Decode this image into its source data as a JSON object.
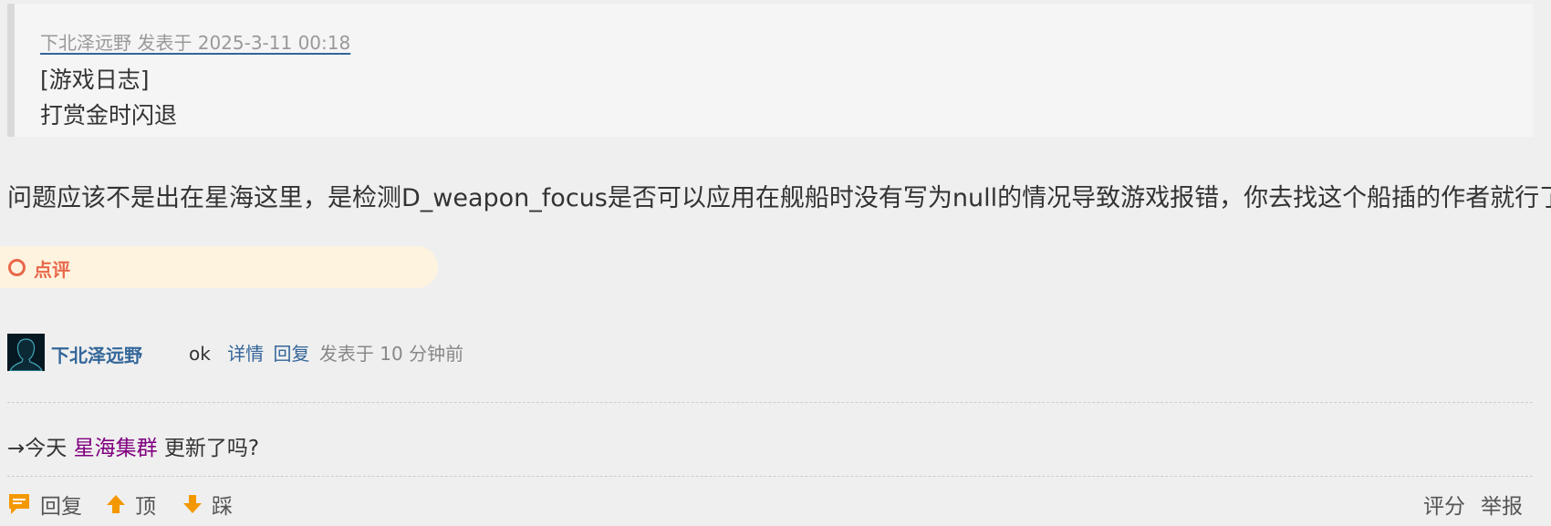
{
  "quote": {
    "meta": "下北泽远野 发表于 2025-3-11 00:18",
    "line1": "[游戏日志]",
    "line2": "打赏金时闪退"
  },
  "post": {
    "text": "问题应该不是出在星海这里，是检测D_weapon_focus是否可以应用在舰船时没有写为null的情况导致游戏报错，你去找这个船插的作者就行了"
  },
  "comments": {
    "label": "点评",
    "items": [
      {
        "username": "下北泽远野",
        "text": "ok",
        "detail_link": "详情",
        "reply_link": "回复",
        "time": "发表于 10 分钟前"
      }
    ]
  },
  "promo": {
    "prefix": "→今天",
    "link": "星海集群",
    "suffix": "更新了吗?"
  },
  "actions": {
    "reply": "回复",
    "up": "顶",
    "down": "踩",
    "rate": "评分",
    "report": "举报"
  },
  "colors": {
    "accent": "#336699",
    "comment_bg": "#fdf3df",
    "comment_fg": "#e8684a",
    "icon_orange": "#f39800",
    "promo_link": "#800080"
  }
}
